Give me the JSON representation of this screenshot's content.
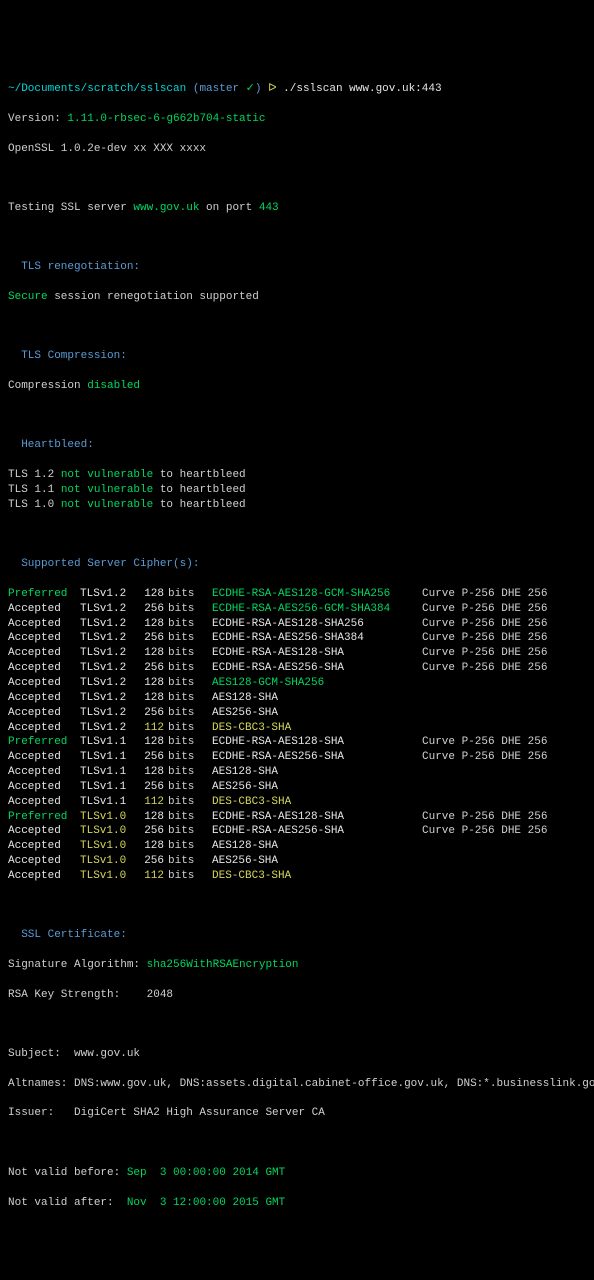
{
  "prompt": {
    "path": "~/Documents/scratch/sslscan",
    "branch": "(master ",
    "check": "✓",
    "branch_close": ")",
    "sep": " ᐅ ",
    "cmd": "./sslscan www.gov.uk:443"
  },
  "version_label": "Version:",
  "version": "1.11.0-rbsec-6-g662b704-static",
  "openssl": "OpenSSL 1.0.2e-dev xx XXX xxxx",
  "testing_pre": "Testing SSL server ",
  "testing_host": "www.gov.uk",
  "testing_mid": " on port ",
  "testing_port": "443",
  "reneg_hdr": "TLS renegotiation:",
  "reneg_secure": "Secure",
  "reneg_text": " session renegotiation supported",
  "compress_hdr": "TLS Compression:",
  "compress_label": "Compression ",
  "compress_status": "disabled",
  "hb_hdr": "Heartbleed:",
  "hb": [
    {
      "proto": "TLS 1.2 ",
      "status": "not vulnerable",
      "suffix": " to heartbleed"
    },
    {
      "proto": "TLS 1.1 ",
      "status": "not vulnerable",
      "suffix": " to heartbleed"
    },
    {
      "proto": "TLS 1.0 ",
      "status": "not vulnerable",
      "suffix": " to heartbleed"
    }
  ],
  "ciphers_hdr": "Supported Server Cipher(s):",
  "ciphers": [
    {
      "status": "Preferred",
      "s_cls": "green",
      "proto": "TLSv1.2",
      "p_cls": "white",
      "bits": "128",
      "b_cls": "white",
      "cipher": "ECDHE-RSA-AES128-GCM-SHA256",
      "c_cls": "green",
      "curve": "Curve P-256 DHE 256"
    },
    {
      "status": "Accepted",
      "s_cls": "white",
      "proto": "TLSv1.2",
      "p_cls": "white",
      "bits": "256",
      "b_cls": "white",
      "cipher": "ECDHE-RSA-AES256-GCM-SHA384",
      "c_cls": "green",
      "curve": "Curve P-256 DHE 256"
    },
    {
      "status": "Accepted",
      "s_cls": "white",
      "proto": "TLSv1.2",
      "p_cls": "white",
      "bits": "128",
      "b_cls": "white",
      "cipher": "ECDHE-RSA-AES128-SHA256",
      "c_cls": "white",
      "curve": "Curve P-256 DHE 256"
    },
    {
      "status": "Accepted",
      "s_cls": "white",
      "proto": "TLSv1.2",
      "p_cls": "white",
      "bits": "256",
      "b_cls": "white",
      "cipher": "ECDHE-RSA-AES256-SHA384",
      "c_cls": "white",
      "curve": "Curve P-256 DHE 256"
    },
    {
      "status": "Accepted",
      "s_cls": "white",
      "proto": "TLSv1.2",
      "p_cls": "white",
      "bits": "128",
      "b_cls": "white",
      "cipher": "ECDHE-RSA-AES128-SHA",
      "c_cls": "white",
      "curve": "Curve P-256 DHE 256"
    },
    {
      "status": "Accepted",
      "s_cls": "white",
      "proto": "TLSv1.2",
      "p_cls": "white",
      "bits": "256",
      "b_cls": "white",
      "cipher": "ECDHE-RSA-AES256-SHA",
      "c_cls": "white",
      "curve": "Curve P-256 DHE 256"
    },
    {
      "status": "Accepted",
      "s_cls": "white",
      "proto": "TLSv1.2",
      "p_cls": "white",
      "bits": "128",
      "b_cls": "white",
      "cipher": "AES128-GCM-SHA256",
      "c_cls": "green",
      "curve": ""
    },
    {
      "status": "Accepted",
      "s_cls": "white",
      "proto": "TLSv1.2",
      "p_cls": "white",
      "bits": "128",
      "b_cls": "white",
      "cipher": "AES128-SHA",
      "c_cls": "white",
      "curve": ""
    },
    {
      "status": "Accepted",
      "s_cls": "white",
      "proto": "TLSv1.2",
      "p_cls": "white",
      "bits": "256",
      "b_cls": "white",
      "cipher": "AES256-SHA",
      "c_cls": "white",
      "curve": ""
    },
    {
      "status": "Accepted",
      "s_cls": "white",
      "proto": "TLSv1.2",
      "p_cls": "white",
      "bits": "112",
      "b_cls": "yellow",
      "cipher": "DES-CBC3-SHA",
      "c_cls": "yellow",
      "curve": ""
    },
    {
      "status": "Preferred",
      "s_cls": "green",
      "proto": "TLSv1.1",
      "p_cls": "white",
      "bits": "128",
      "b_cls": "white",
      "cipher": "ECDHE-RSA-AES128-SHA",
      "c_cls": "white",
      "curve": "Curve P-256 DHE 256"
    },
    {
      "status": "Accepted",
      "s_cls": "white",
      "proto": "TLSv1.1",
      "p_cls": "white",
      "bits": "256",
      "b_cls": "white",
      "cipher": "ECDHE-RSA-AES256-SHA",
      "c_cls": "white",
      "curve": "Curve P-256 DHE 256"
    },
    {
      "status": "Accepted",
      "s_cls": "white",
      "proto": "TLSv1.1",
      "p_cls": "white",
      "bits": "128",
      "b_cls": "white",
      "cipher": "AES128-SHA",
      "c_cls": "white",
      "curve": ""
    },
    {
      "status": "Accepted",
      "s_cls": "white",
      "proto": "TLSv1.1",
      "p_cls": "white",
      "bits": "256",
      "b_cls": "white",
      "cipher": "AES256-SHA",
      "c_cls": "white",
      "curve": ""
    },
    {
      "status": "Accepted",
      "s_cls": "white",
      "proto": "TLSv1.1",
      "p_cls": "white",
      "bits": "112",
      "b_cls": "yellow",
      "cipher": "DES-CBC3-SHA",
      "c_cls": "yellow",
      "curve": ""
    },
    {
      "status": "Preferred",
      "s_cls": "green",
      "proto": "TLSv1.0",
      "p_cls": "yellow",
      "bits": "128",
      "b_cls": "white",
      "cipher": "ECDHE-RSA-AES128-SHA",
      "c_cls": "white",
      "curve": "Curve P-256 DHE 256"
    },
    {
      "status": "Accepted",
      "s_cls": "white",
      "proto": "TLSv1.0",
      "p_cls": "yellow",
      "bits": "256",
      "b_cls": "white",
      "cipher": "ECDHE-RSA-AES256-SHA",
      "c_cls": "white",
      "curve": "Curve P-256 DHE 256"
    },
    {
      "status": "Accepted",
      "s_cls": "white",
      "proto": "TLSv1.0",
      "p_cls": "yellow",
      "bits": "128",
      "b_cls": "white",
      "cipher": "AES128-SHA",
      "c_cls": "white",
      "curve": ""
    },
    {
      "status": "Accepted",
      "s_cls": "white",
      "proto": "TLSv1.0",
      "p_cls": "yellow",
      "bits": "256",
      "b_cls": "white",
      "cipher": "AES256-SHA",
      "c_cls": "white",
      "curve": ""
    },
    {
      "status": "Accepted",
      "s_cls": "white",
      "proto": "TLSv1.0",
      "p_cls": "yellow",
      "bits": "112",
      "b_cls": "yellow",
      "cipher": "DES-CBC3-SHA",
      "c_cls": "yellow",
      "curve": ""
    }
  ],
  "bits_label": "bits",
  "cert_hdr": "SSL Certificate:",
  "cert": {
    "sigalg_label": "Signature Algorithm: ",
    "sigalg": "sha256WithRSAEncryption",
    "rsa_label": "RSA Key Strength:    ",
    "rsa": "2048",
    "subject_label": "Subject:  ",
    "subject": "www.gov.uk",
    "alt_label": "Altnames: ",
    "alt": "DNS:www.gov.uk, DNS:assets.digital.cabinet-office.gov.uk, DNS:*.businesslink.gov.uk, DNS:*.direct.gov",
    "issuer_label": "Issuer:   ",
    "issuer": "DigiCert SHA2 High Assurance Server CA",
    "nvb_label": "Not valid before: ",
    "nvb": "Sep  3 00:00:00 2014 GMT",
    "nva_label": "Not valid after:  ",
    "nva": "Nov  3 12:00:00 2015 GMT"
  }
}
